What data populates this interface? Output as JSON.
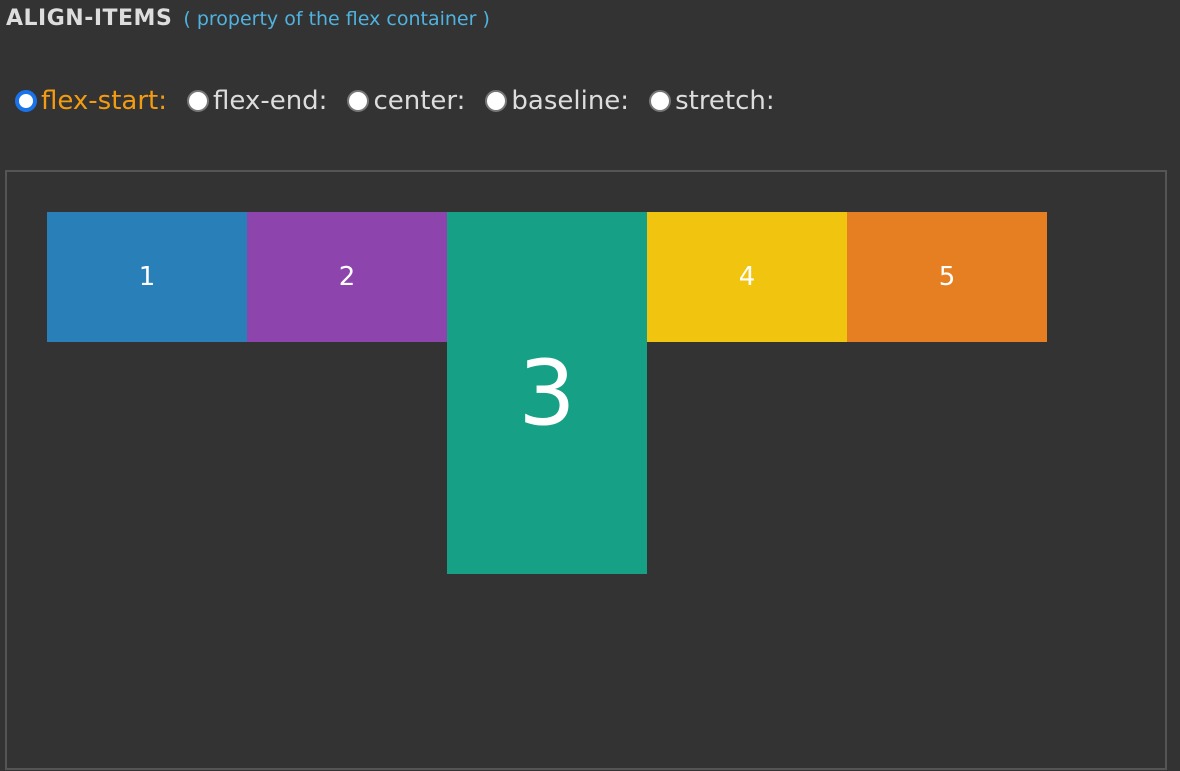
{
  "header": {
    "title": "ALIGN-ITEMS",
    "subtitle": "( property of the flex container )"
  },
  "options": [
    {
      "label": "flex-start:",
      "selected": true
    },
    {
      "label": "flex-end:",
      "selected": false
    },
    {
      "label": "center:",
      "selected": false
    },
    {
      "label": "baseline:",
      "selected": false
    },
    {
      "label": "stretch:",
      "selected": false
    }
  ],
  "items": [
    {
      "label": "1",
      "color": "#2980b9"
    },
    {
      "label": "2",
      "color": "#8e44ad"
    },
    {
      "label": "3",
      "color": "#16a085"
    },
    {
      "label": "4",
      "color": "#f1c40f"
    },
    {
      "label": "5",
      "color": "#e67e22"
    }
  ],
  "colors": {
    "selected": "#f39c12",
    "subtitle": "#4fb3e0",
    "background": "#333333"
  }
}
